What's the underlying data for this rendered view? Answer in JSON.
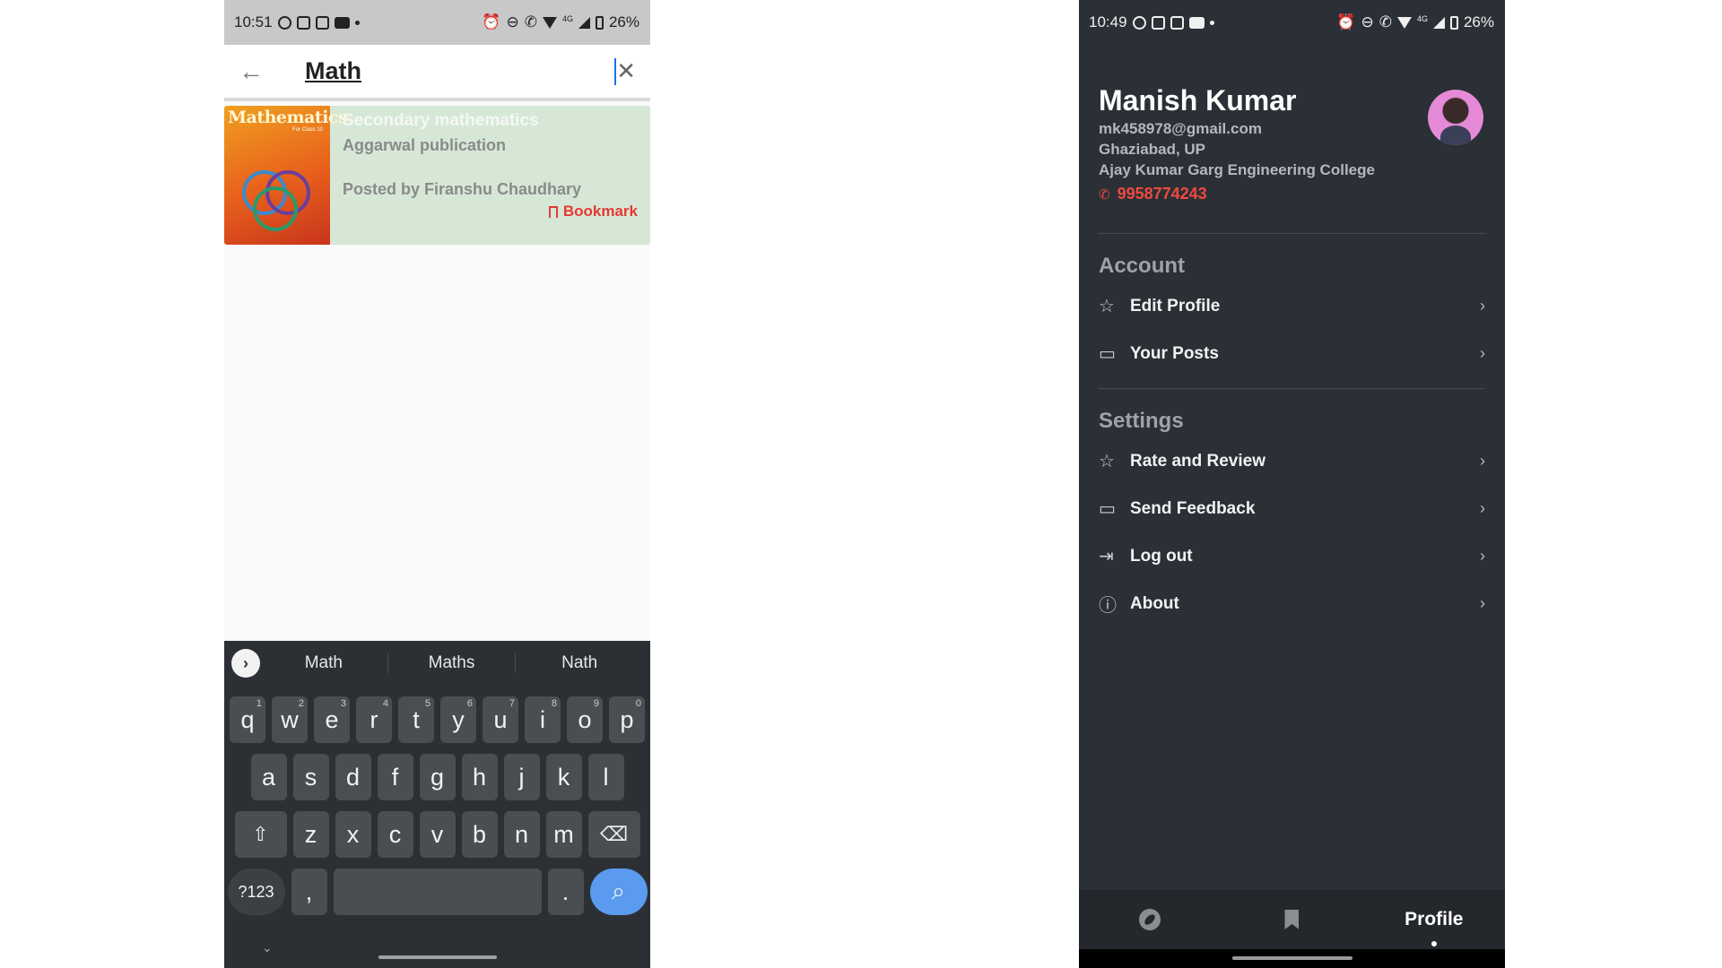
{
  "left": {
    "statusbar": {
      "time": "10:51",
      "battery": "26%",
      "network": "4G"
    },
    "search": {
      "query": "Math"
    },
    "result": {
      "cover_title": "Mathematics",
      "cover_subtitle": "For Class 10",
      "title": "Secondary mathematics",
      "publisher": "Aggarwal publication",
      "posted_by": "Posted by Firanshu Chaudhary",
      "bookmark_label": "Bookmark",
      "accent": "#e53935",
      "card_color": "#d6e7d6"
    },
    "keyboard": {
      "suggestions": [
        "Math",
        "Maths",
        "Nath"
      ],
      "row1": [
        {
          "k": "q",
          "n": "1"
        },
        {
          "k": "w",
          "n": "2"
        },
        {
          "k": "e",
          "n": "3"
        },
        {
          "k": "r",
          "n": "4"
        },
        {
          "k": "t",
          "n": "5"
        },
        {
          "k": "y",
          "n": "6"
        },
        {
          "k": "u",
          "n": "7"
        },
        {
          "k": "i",
          "n": "8"
        },
        {
          "k": "o",
          "n": "9"
        },
        {
          "k": "p",
          "n": "0"
        }
      ],
      "row2": [
        "a",
        "s",
        "d",
        "f",
        "g",
        "h",
        "j",
        "k",
        "l"
      ],
      "row3": [
        "z",
        "x",
        "c",
        "v",
        "b",
        "n",
        "m"
      ],
      "sym_label": "?123",
      "comma_label": ",",
      "period_label": ".",
      "search_color": "#5a9bf0"
    }
  },
  "right": {
    "statusbar": {
      "time": "10:49",
      "battery": "26%",
      "network": "4G"
    },
    "profile": {
      "name": "Manish Kumar",
      "email": "mk458978@gmail.com",
      "location": "Ghaziabad, UP",
      "college": "Ajay Kumar Garg Engineering College",
      "phone": "9958774243",
      "phone_color": "#ef4a3f"
    },
    "account": {
      "title": "Account",
      "items": [
        {
          "label": "Edit Profile",
          "icon": "star-outline-icon"
        },
        {
          "label": "Your Posts",
          "icon": "comment-alert-icon"
        }
      ]
    },
    "settings": {
      "title": "Settings",
      "items": [
        {
          "label": "Rate and Review",
          "icon": "star-outline-icon"
        },
        {
          "label": "Send Feedback",
          "icon": "feedback-icon"
        },
        {
          "label": "Log out",
          "icon": "logout-icon"
        },
        {
          "label": "About",
          "icon": "info-icon"
        }
      ]
    },
    "bottom_nav": {
      "tabs": [
        {
          "label": "",
          "icon": "compass-icon"
        },
        {
          "label": "",
          "icon": "bookmark-add-icon"
        },
        {
          "label": "Profile",
          "icon": ""
        }
      ],
      "active": "Profile"
    }
  }
}
